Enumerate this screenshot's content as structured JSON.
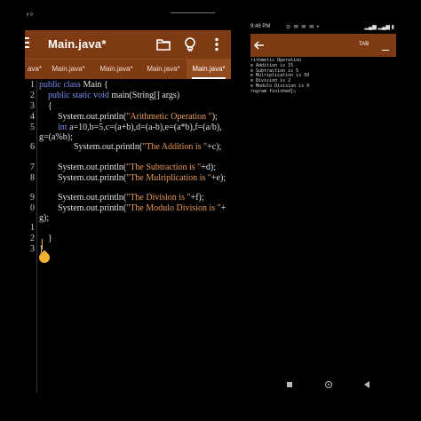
{
  "editor": {
    "status_left": "ʸ ᵉ",
    "title": "Main.java*",
    "tabs": [
      {
        "label": "ava*"
      },
      {
        "label": "Main.java*"
      },
      {
        "label": "Main.java*"
      },
      {
        "label": "Main.java*"
      },
      {
        "label": "Main.java*"
      }
    ],
    "active_tab_index": 4,
    "gutter": [
      "1",
      "2",
      "3",
      "4",
      "5",
      "6",
      "7",
      "8",
      "9",
      "0",
      "1",
      "2",
      "3"
    ],
    "code": {
      "l1_kw": "public class",
      "l1_rest": " Main {",
      "l2_kw": "public static void",
      "l2_rest": " main(String[] args)",
      "l3": "{",
      "l4_a": "System.out.println(",
      "l4_s": "\"Arithmetic Operation \"",
      "l4_b": ");",
      "l5_kw": "int",
      "l5_rest": " a=10,b=5,c=(a+b),d=(a-b),e=(a*b),f=(a/b),",
      "l5_wrap": "g=(a%b);",
      "l6_a": "System.out.println(",
      "l6_s": "\"The Addition is \"",
      "l6_b": "+c);",
      "l7_a": "System.out.println(",
      "l7_s": "\"The Subtraction is \"",
      "l7_b": "+d);",
      "l8_a": "System.out.println(",
      "l8_s": "\"The Mulriplication is \"",
      "l8_b": "+e);",
      "l9_a": "System.out.println(",
      "l9_s": "\"The Division is \"",
      "l9_b": "+f);",
      "l10_a": "System.out.println(",
      "l10_s": "\"The Modulo Division is \"",
      "l10_b": "+",
      "l10_wrap": "g);",
      "l12": "}",
      "l13": "}"
    }
  },
  "console": {
    "status_time": "9:46 PM",
    "status_icons": "⊙ ✉ ✉ ✉ •",
    "status_signal": "▂▄▆ ▂▄▆ ▮",
    "tab_key": "TAB",
    "output": [
      "rithmetic Operation",
      "e Addition is 15",
      "e Subtraction is 5",
      "e Mulriplication is 50",
      "e Division is 2",
      "e Modulo Division is 0",
      "",
      "rogram finished]▯"
    ]
  },
  "colors": {
    "toolbar": "#7d3a13",
    "keyword": "#7a8ef0",
    "string": "#e89a58",
    "cursor": "#f0b030"
  }
}
